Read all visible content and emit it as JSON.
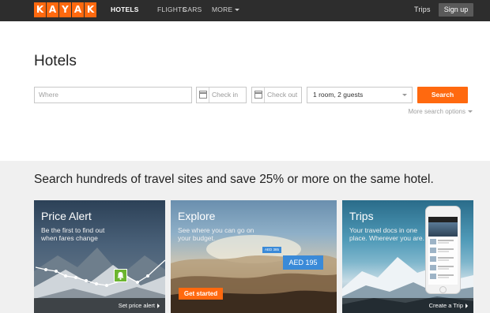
{
  "header": {
    "logo_letters": [
      "K",
      "A",
      "Y",
      "A",
      "K"
    ],
    "nav": {
      "hotels": "HOTELS",
      "flights": "FLIGHTS",
      "cars": "CARS",
      "more": "MORE"
    },
    "trips": "Trips",
    "signup": "Sign up"
  },
  "search": {
    "title": "Hotels",
    "where_placeholder": "Where",
    "checkin": "Check in",
    "checkout": "Check out",
    "rooms": "1 room, 2 guests",
    "button": "Search",
    "more_options": "More search options"
  },
  "promo": {
    "tagline": "Search hundreds of travel sites and save 25% or more on the same hotel.",
    "cards": [
      {
        "title": "Price Alert",
        "desc": "Be the first to find out when fares change",
        "link": "Set price alert"
      },
      {
        "title": "Explore",
        "desc": "See where you can go on your budget.",
        "button": "Get started",
        "tag_small": "AED 385",
        "tag_big": "AED 195"
      },
      {
        "title": "Trips",
        "desc": "Your travel docs in one place. Wherever you are.",
        "link": "Create a Trip"
      }
    ]
  },
  "colors": {
    "brand_orange": "#ff690f",
    "nav_bg": "#2d2d2d",
    "alert_green": "#6cb530",
    "tag_blue": "#3a8ad8"
  }
}
